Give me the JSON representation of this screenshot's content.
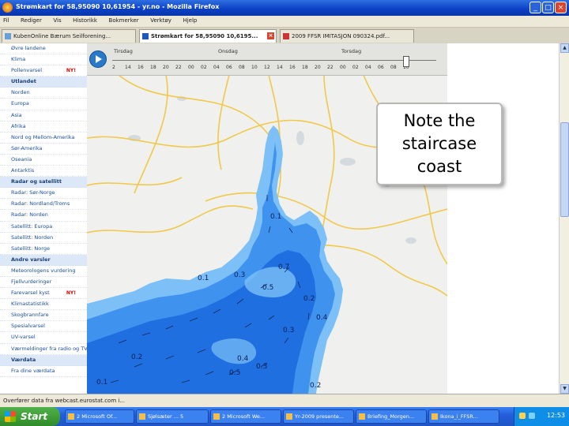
{
  "window": {
    "title": "Strømkart for 58,95090 10,61954 - yr.no - Mozilla Firefox"
  },
  "menu": [
    "Fil",
    "Rediger",
    "Vis",
    "Historikk",
    "Bokmerker",
    "Verktøy",
    "Hjelp"
  ],
  "tabs": [
    {
      "label": "KubenOnline Bærum Seilforening...",
      "active": false
    },
    {
      "label": "Strømkart for 58,95090 10,6195...",
      "active": true
    },
    {
      "label": "2009 FFSR IMITASJON 090324.pdf...",
      "active": false
    }
  ],
  "sidebar": [
    {
      "label": "Øvre landene",
      "header": false
    },
    {
      "label": "Klima",
      "header": false
    },
    {
      "label": "Pollenvarsel",
      "header": false,
      "badge": "NY!"
    },
    {
      "label": "Utlandet",
      "header": true
    },
    {
      "label": "Norden",
      "header": false
    },
    {
      "label": "Europa",
      "header": false
    },
    {
      "label": "Asia",
      "header": false
    },
    {
      "label": "Afrika",
      "header": false
    },
    {
      "label": "Nord og Mellom-Amerika",
      "header": false
    },
    {
      "label": "Sør-Amerika",
      "header": false
    },
    {
      "label": "Oseania",
      "header": false
    },
    {
      "label": "Antarktis",
      "header": false
    },
    {
      "label": "Radar og satellitt",
      "header": true
    },
    {
      "label": "Radar: Sør-Norge",
      "header": false
    },
    {
      "label": "Radar: Nordland/Troms",
      "header": false
    },
    {
      "label": "Radar: Norden",
      "header": false
    },
    {
      "label": "Satellitt: Europa",
      "header": false
    },
    {
      "label": "Satellitt: Norden",
      "header": false
    },
    {
      "label": "Satellitt: Norge",
      "header": false
    },
    {
      "label": "Andre varsler",
      "header": true
    },
    {
      "label": "Meteorologens vurdering",
      "header": false
    },
    {
      "label": "Fjellvurderinger",
      "header": false
    },
    {
      "label": "Farevarsel kyst",
      "header": false,
      "badge": "NY!"
    },
    {
      "label": "Klimastatistikk",
      "header": false
    },
    {
      "label": "Skogbrannfare",
      "header": false
    },
    {
      "label": "Spesialvarsel",
      "header": false
    },
    {
      "label": "UV-varsel",
      "header": false
    },
    {
      "label": "Værmeldinger fra radio og TV",
      "header": false
    },
    {
      "label": "Værdata",
      "header": true
    },
    {
      "label": "Fra dine værdata",
      "header": false
    }
  ],
  "timeline": {
    "days": [
      "Tirsdag",
      "Onsdag",
      "Torsdag"
    ],
    "hours": [
      "2",
      "14",
      "16",
      "18",
      "20",
      "22",
      "00",
      "02",
      "04",
      "06",
      "08",
      "10",
      "12",
      "14",
      "16",
      "18",
      "20",
      "22",
      "00",
      "02",
      "04",
      "06",
      "08",
      "10"
    ]
  },
  "map_labels": [
    "0.1",
    "0.3",
    "0.5",
    "0.7",
    "0.2",
    "0.4",
    "0.3",
    "0.1",
    "0.2",
    "0.4",
    "0.3",
    "0.2",
    "0.5",
    "0.1"
  ],
  "callout": {
    "text": "Note the\nstaircase\ncoast"
  },
  "status": {
    "text": "Overfører data fra webcast.eurostat.com i..."
  },
  "taskbar": {
    "start_label": "Start",
    "items": [
      "2 Microsoft Of...",
      "Sjølsæter ... 5",
      "2 Microsoft We...",
      "Yr-2009 presente...",
      "Briefing_Morgen...",
      "Ikona_i_FFSR..."
    ],
    "clock": "12:53"
  },
  "colors": {
    "sea_dark": "#1f6fe0",
    "sea_mid": "#3f93ee",
    "sea_light": "#7cc0f7",
    "land": "#f1f1ee",
    "road": "#f0c84a"
  }
}
